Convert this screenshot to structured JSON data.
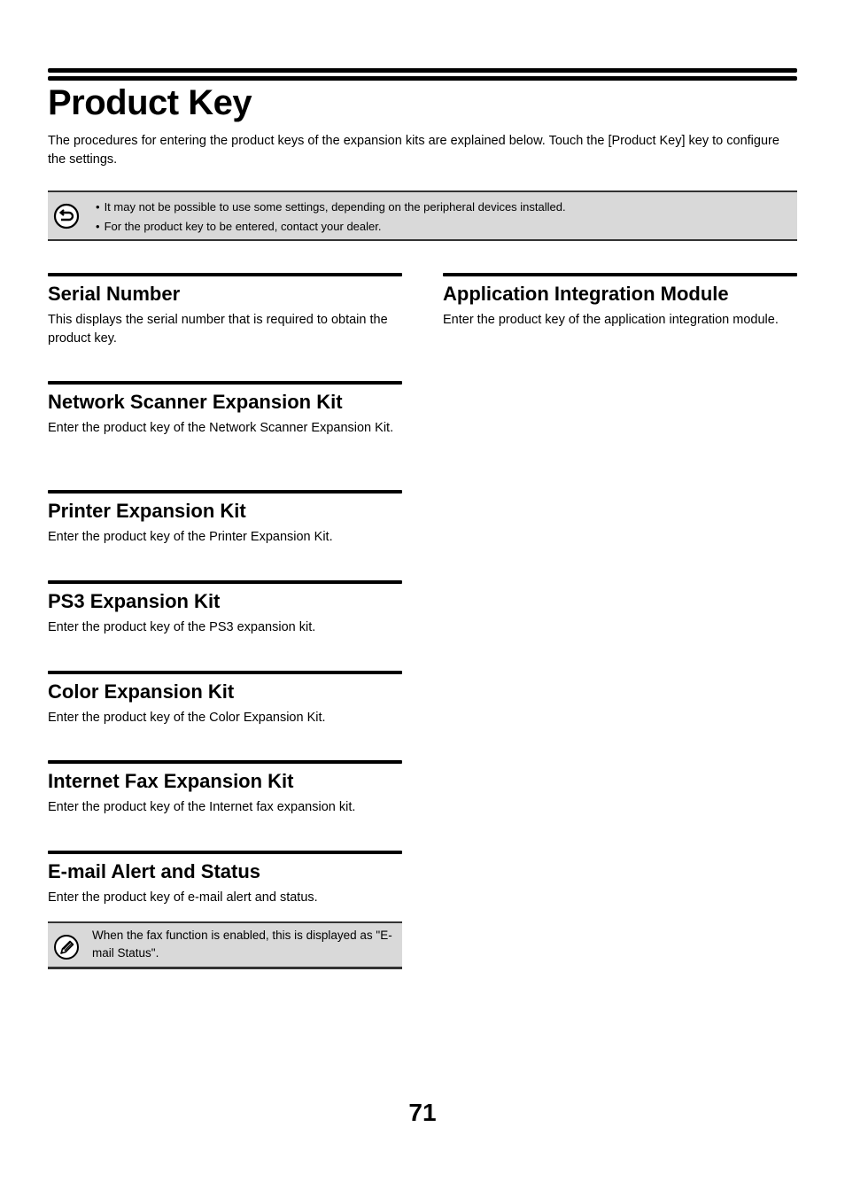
{
  "page": {
    "title": "Product Key",
    "intro": "The procedures for entering the product keys of the expansion kits are explained below. Touch the [Product Key] key to configure the settings.",
    "page_number": "71"
  },
  "note_box": {
    "icon": "return-arrow-icon",
    "items": [
      "It may not be possible to use some settings, depending on the peripheral devices installed.",
      "For the product key to be entered, contact your dealer."
    ]
  },
  "left_column": [
    {
      "title": "Serial Number",
      "text": "This displays the serial number that is required to obtain the product key."
    },
    {
      "title": "Network Scanner Expansion Kit",
      "text": "Enter the product key of the Network Scanner Expansion Kit."
    },
    {
      "title": "Printer Expansion Kit",
      "text": "Enter the product key of the Printer Expansion Kit."
    },
    {
      "title": "PS3 Expansion Kit",
      "text": "Enter the product key of the PS3 expansion kit."
    },
    {
      "title": "Color Expansion Kit",
      "text": "Enter the product key of the Color Expansion Kit."
    },
    {
      "title": "Internet Fax Expansion Kit",
      "text": "Enter the product key of the Internet fax expansion kit."
    },
    {
      "title": "E-mail Alert and Status",
      "text": "Enter the product key of e-mail alert and status."
    }
  ],
  "right_column": [
    {
      "title": "Application Integration Module",
      "text": "Enter the product key of the application integration module."
    }
  ],
  "tip_box": {
    "icon": "pencil-icon",
    "text": "When the fax function is enabled, this is displayed as \"E-mail Status\"."
  },
  "colors": {
    "note_background": "#d9d9d9",
    "note_border": "#333333",
    "text": "#000000"
  }
}
